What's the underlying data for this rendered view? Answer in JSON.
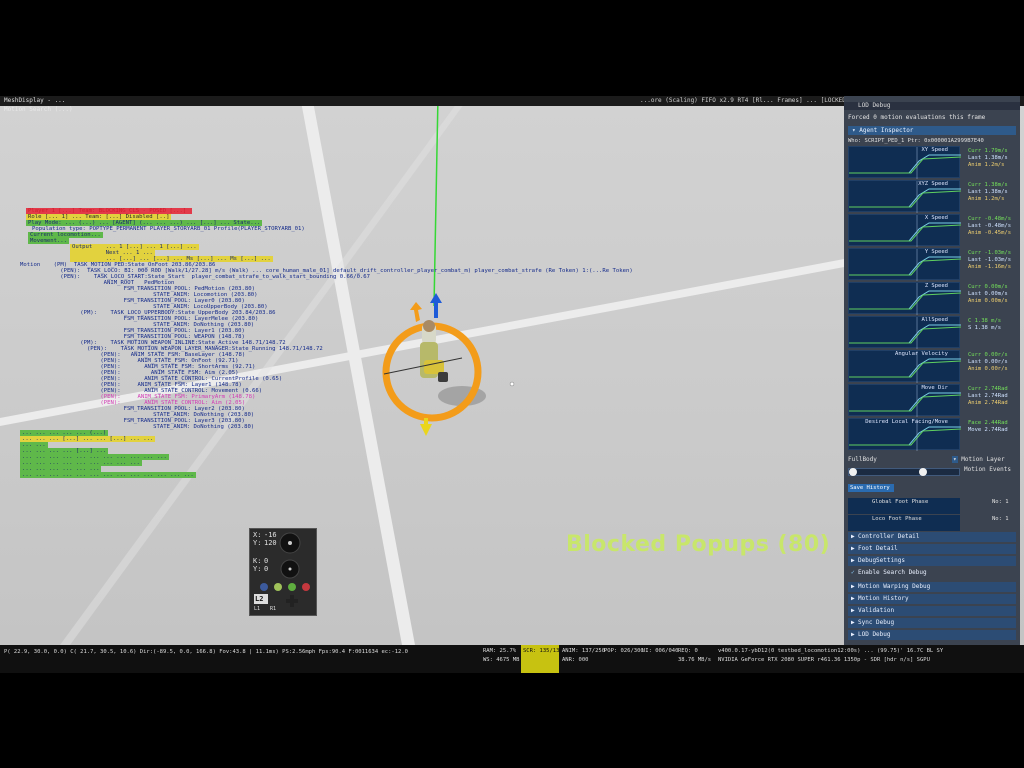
{
  "colors": {
    "accent_orange": "#f39c1a",
    "highlight_red": "#e23a4a",
    "highlight_yellow": "#e2d23e",
    "highlight_green": "#5fb84a",
    "panel_blue": "#2c4c74",
    "text_blue": "#142a8a",
    "magenta": "#d23ab4"
  },
  "window": {
    "title": "MeshDisplay - ...",
    "top_right_text": "...ore (Scaling) FIFO x2.9 RT4 [Rl... Frames] ... [LOCKED] ... Version: ... 2.0 ... [FPS 60.0] Status ...",
    "debug_tab_label": "Motion Search (...)"
  },
  "debug_overlay": {
    "lines": [
      {
        "text": "Player 1 [...] Team: BLOCKING_CLS - POSED [...] ",
        "color": "#d11c2b",
        "bg": "#e23a4a"
      },
      {
        "text": "Role [... 1] ... Team: [...] Disabled [..]",
        "color": "#2a2a2a",
        "bg": "#e2d23e"
      },
      {
        "text": "Play Mode: ... (...) ... [AGENT] (... ... ...) ... [...] ... State...",
        "color": "#1c2c6a",
        "bg": "#5fb84a"
      },
      {
        "text": "Population type: POPTYPE_PERMANENT PLAYER_STORYARB_01 Profile(PLAYER_STORYARB_01)",
        "color": "#142a8a",
        "bg": ""
      },
      {
        "text": "Current locomotion...",
        "color": "#1c2c6a",
        "bg": "#5fb84a"
      },
      {
        "text": "Movement...",
        "color": "#1c2c6a",
        "bg": "#5fb84a"
      },
      {
        "text": "Output    ... 1 [...] ... 1 [...] ...",
        "color": "#1c2c6a",
        "bg": "#e2d23e"
      },
      {
        "text": "          Next ... 1 ...",
        "color": "#1c2c6a",
        "bg": "#e2d23e"
      },
      {
        "text": "          ... [...] ... [...] ... Ms [...] ... Ms [...] ...",
        "color": "#1c2c6a",
        "bg": "#e2d23e"
      },
      {
        "text": "Motion    (PM)  TASK_MOTION_PED:State_OnFoot 203.86/203.86",
        "color": "#142a8a",
        "bg": ""
      },
      {
        "text": "      (PEN):  TASK_LOCO: BI: 000 R0D [Walk/1/27.28] m/s (Walk) ... core_human_male_01] default_drift_controller_player_combat_m) player_combat_strafe (Re Token) 1:(...Re Token)",
        "color": "#142a8a",
        "bg": ""
      },
      {
        "text": "      (PEN):    TASK_LOCO_START:State_Start  player_combat_strafe_to_walk_start_bounding 0.66/0.67",
        "color": "#142a8a",
        "bg": ""
      },
      {
        "text": "          ANIM_ROOT   PedMotion",
        "color": "#142a8a",
        "bg": ""
      },
      {
        "text": "          FSM_TRANSITION_POOL: PedMotion (203.80)",
        "color": "#142a8a",
        "bg": ""
      },
      {
        "text": "              STATE_ANIM: Locomotion (203.80)",
        "color": "#142a8a",
        "bg": ""
      },
      {
        "text": "          FSM_TRANSITION_POOL: Layer0 (203.80)",
        "color": "#142a8a",
        "bg": ""
      },
      {
        "text": "              STATE_ANIM: LocoUpperBody (203.80)",
        "color": "#142a8a",
        "bg": ""
      },
      {
        "text": "      (PM):    TASK_LOCO_UPPERBODY:State_UpperBody 203.84/203.86",
        "color": "#142a8a",
        "bg": ""
      },
      {
        "text": "          FSM_TRANSITION_POOL: LayerMelee (203.80)",
        "color": "#142a8a",
        "bg": ""
      },
      {
        "text": "              STATE_ANIM: DoNothing (203.80)",
        "color": "#142a8a",
        "bg": ""
      },
      {
        "text": "          FSM_TRANSITION_POOL: Layer1 (203.80)",
        "color": "#142a8a",
        "bg": ""
      },
      {
        "text": "          FSM_TRANSITION_POOL: WEAPON (148.78)",
        "color": "#142a8a",
        "bg": ""
      },
      {
        "text": "      (PM):    TASK_MOTION_WEAPON_INLINE:State_Active 148.71/148.72",
        "color": "#142a8a",
        "bg": ""
      },
      {
        "text": "        (PEN):    TASK_MOTION_WEAPON_LAYER_MANAGER:State_Running 148.71/148.72",
        "color": "#142a8a",
        "bg": ""
      },
      {
        "text": "            (PEN):   ANIM_STATE_FSM: BaseLayer (148.78)",
        "color": "#142a8a",
        "bg": ""
      },
      {
        "text": "            (PEN):     ANIM_STATE_FSM: OnFoot (92.71)",
        "color": "#142a8a",
        "bg": ""
      },
      {
        "text": "            (PEN):       ANIM_STATE_FSM: ShortArms (92.71)",
        "color": "#142a8a",
        "bg": ""
      },
      {
        "text": "            (PEN):         ANIM_STATE_FSM: Aim (2.05)",
        "color": "#142a8a",
        "bg": ""
      },
      {
        "text": "            (PEN):       ANIM_STATE_CONTROL: CurrentProfile (0.65)",
        "color": "#142a8a",
        "bg": ""
      },
      {
        "text": "            (PEN):     ANIM_STATE_FSM: Layer1 (148.78)",
        "color": "#142a8a",
        "bg": ""
      },
      {
        "text": "            (PEN):       ANIM_STATE_CONTROL: Movement (0.66)",
        "color": "#142a8a",
        "bg": ""
      },
      {
        "text": "            (PEN):     ANIM_STATE_FSM: PrimaryArm (148.78)",
        "color": "#d23ab4",
        "bg": ""
      },
      {
        "text": "            (PEN):       ANIM_STATE_CONTROL: Aim (2.05)",
        "color": "#d23ab4",
        "bg": ""
      },
      {
        "text": "          FSM_TRANSITION_POOL: Layer2 (203.80)",
        "color": "#142a8a",
        "bg": ""
      },
      {
        "text": "              STATE_ANIM: DoNothing (203.80)",
        "color": "#142a8a",
        "bg": ""
      },
      {
        "text": "          FSM_TRANSITION_POOL: Layer3 (203.80)",
        "color": "#142a8a",
        "bg": ""
      },
      {
        "text": "              STATE_ANIM: DoNothing (203.80)",
        "color": "#142a8a",
        "bg": ""
      },
      {
        "text": "... ... ... ... ... (...)",
        "color": "#1c2c6a",
        "bg": "#5fb84a"
      },
      {
        "text": "... ... ... [...] ... ... [...] ... ...",
        "color": "#1c2c6a",
        "bg": "#e2d23e"
      },
      {
        "text": "... ...",
        "color": "#1c2c6a",
        "bg": "#5fb84a"
      },
      {
        "text": "... ... ... ... [...] ...",
        "color": "#1c2c6a",
        "bg": "#5fb84a"
      },
      {
        "text": "... ... ... ... ... ... ... ... ... ... ...",
        "color": "#1c2c6a",
        "bg": "#5fb84a"
      },
      {
        "text": "... ... ... ... ... ... ... ... ...",
        "color": "#1c2c6a",
        "bg": "#5fb84a"
      },
      {
        "text": "... ... ... ... ... ...",
        "color": "#1c2c6a",
        "bg": "#5fb84a"
      },
      {
        "text": "... ... ... ... ... ... ... ... ... ... ... ... ...",
        "color": "#1c2c6a",
        "bg": "#5fb84a"
      }
    ]
  },
  "blocked_popups": "Blocked Popups (80)",
  "controller": {
    "x_label": "X:",
    "x_value": "-16",
    "y_label": "Y:",
    "y_value": "120",
    "k_label": "K:",
    "k_value": "0",
    "y2_label": "Y:",
    "y2_value": "0",
    "l2": "L2",
    "left_small": "L1",
    "right_small": "R1"
  },
  "panel": {
    "title": "LOD Debug",
    "forced": "Forced 0 motion evaluations this frame",
    "agent_inspector": "Agent Inspector",
    "who": "Who: SCRIPT_PED_1 Ptr: 0x000001A2999B7E40",
    "graphs": [
      {
        "label": "XY Speed",
        "v1": "Curr 1.79m/s",
        "v2": "Last 1.38m/s",
        "v3": "Anim 1.2m/s"
      },
      {
        "label": "XYZ Speed",
        "v1": "Curr 1.38m/s",
        "v2": "Last 1.38m/s",
        "v3": "Anim 1.2m/s"
      },
      {
        "label": "X Speed",
        "v1": "Curr -0.48m/s",
        "v2": "Last -0.48m/s",
        "v3": "Anim -0.45m/s"
      },
      {
        "label": "Y Speed",
        "v1": "Curr -1.03m/s",
        "v2": "Last -1.03m/s",
        "v3": "Anim -1.16m/s"
      },
      {
        "label": "Z Speed",
        "v1": "Curr 0.00m/s",
        "v2": "Last 0.00m/s",
        "v3": "Anim 0.00m/s"
      },
      {
        "label": "AllSpeed",
        "v1": "C 1.38 m/s",
        "v2": "S 1.38 m/s",
        "v3": ""
      },
      {
        "label": "Angular Velocity",
        "v1": "Curr 0.00r/s",
        "v2": "Last 0.00r/s",
        "v3": "Anim 0.00r/s"
      },
      {
        "label": "Move Dir",
        "v1": "Curr 2.74Rad",
        "v2": "Last 2.74Rad",
        "v3": "Anim 2.74Rad"
      },
      {
        "label": "Desired Local Facing/Move",
        "v1": "Face 2.44Rad",
        "v2": "Move 2.74Rad",
        "v3": ""
      }
    ],
    "full_body": "FullBody",
    "motion_layer_label": "Motion Layer",
    "motion_events_label": "Motion Events",
    "save_history": "Save History",
    "global_foot_phase": "Global Foot Phase",
    "global_foot_phase_value": "No: 1",
    "loco_foot_phase": "Loco Foot Phase",
    "loco_foot_phase_value": "No: 1",
    "menu": [
      "Controller Detail",
      "Foot Detail",
      "DebugSettings"
    ],
    "enable_search_debug": "Enable Search Debug",
    "menu2": [
      "Motion Warping Debug",
      "Motion History",
      "Validation",
      "Sync Debug",
      "LOD Debug"
    ]
  },
  "status": {
    "left": "P( 22.9,  30.0,  0.0) C( 21.7,  30.5,  10.6) Dir:(-89.5,  0.0, 166.8) Fov:43.8 | 11.1ms) PS:2.56mph Fps:90.4 F:0011634 ec:-12.0",
    "ram": "RAM: 25.7%",
    "ws": "WS: 4675 MB",
    "scr": "SCR: 135/135",
    "anim": "ANIM: 137/250",
    "pop": "POP: 026/300",
    "ui": "UI: 006/040",
    "req": "REQ: 0",
    "anr": "ANR: 000",
    "mbs": "38.76 MB/s",
    "right1": "v400.0.17-ybD12(0 testbed_locomotion12:00s) ... (99.75)' 16.7C BL SY",
    "right2": "NVIDIA GeForce RTX 2080 SUPER r461.36 1350p - SDR [hdr n/s] SGPU"
  }
}
